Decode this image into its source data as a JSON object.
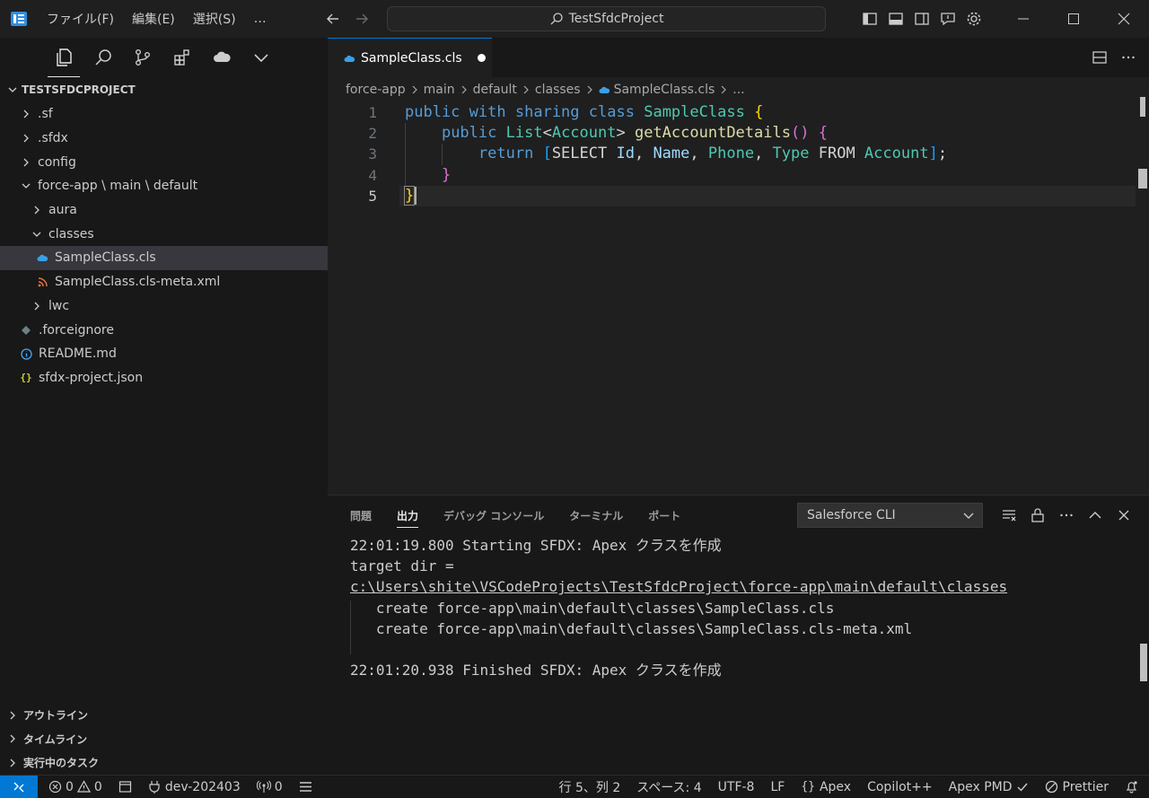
{
  "titlebar": {
    "menu": [
      "ファイル(F)",
      "編集(E)",
      "選択(S)",
      "…"
    ],
    "search": "TestSfdcProject"
  },
  "explorer": {
    "project": "TESTSFDCPROJECT",
    "items": [
      {
        "label": ".sf",
        "type": "folder"
      },
      {
        "label": ".sfdx",
        "type": "folder"
      },
      {
        "label": "config",
        "type": "folder"
      },
      {
        "label": "force-app \\ main \\ default",
        "type": "folder-open"
      },
      {
        "label": "aura",
        "type": "folder"
      },
      {
        "label": "classes",
        "type": "folder-open"
      },
      {
        "label": "SampleClass.cls",
        "type": "apex-file"
      },
      {
        "label": "SampleClass.cls-meta.xml",
        "type": "xml-file"
      },
      {
        "label": "lwc",
        "type": "folder"
      },
      {
        "label": ".forceignore",
        "type": "ignore-file"
      },
      {
        "label": "README.md",
        "type": "info-file"
      },
      {
        "label": "sfdx-project.json",
        "type": "json-file"
      }
    ],
    "bottom_views": [
      "アウトライン",
      "タイムライン",
      "実行中のタスク"
    ]
  },
  "editor": {
    "tab": "SampleClass.cls",
    "breadcrumb": [
      "force-app",
      "main",
      "default",
      "classes",
      "SampleClass.cls",
      "..."
    ],
    "line_numbers": [
      "1",
      "2",
      "3",
      "4",
      "5"
    ]
  },
  "panel": {
    "tabs": [
      "問題",
      "出力",
      "デバッグ コンソール",
      "ターミナル",
      "ポート"
    ],
    "channel": "Salesforce CLI",
    "output": [
      "22:01:19.800 Starting SFDX: Apex クラスを作成",
      "target dir =",
      "c:\\Users\\shite\\VSCodeProjects\\TestSfdcProject\\force-app\\main\\default\\classes",
      "   create force-app\\main\\default\\classes\\SampleClass.cls",
      "   create force-app\\main\\default\\classes\\SampleClass.cls-meta.xml",
      "",
      "22:01:20.938 Finished SFDX: Apex クラスを作成"
    ]
  },
  "statusbar": {
    "errors": "0",
    "warnings": "0",
    "branch": "dev-202403",
    "ports": "0",
    "position": "行 5、列 2",
    "spaces": "スペース: 4",
    "encoding": "UTF-8",
    "eol": "LF",
    "language": "Apex",
    "copilot": "Copilot++",
    "pmd": "Apex PMD",
    "prettier": "Prettier"
  },
  "colors": {
    "accent": "#0078d4",
    "keyword": "#569cd6",
    "type": "#4ec9b0",
    "function": "#dcdcaa"
  }
}
